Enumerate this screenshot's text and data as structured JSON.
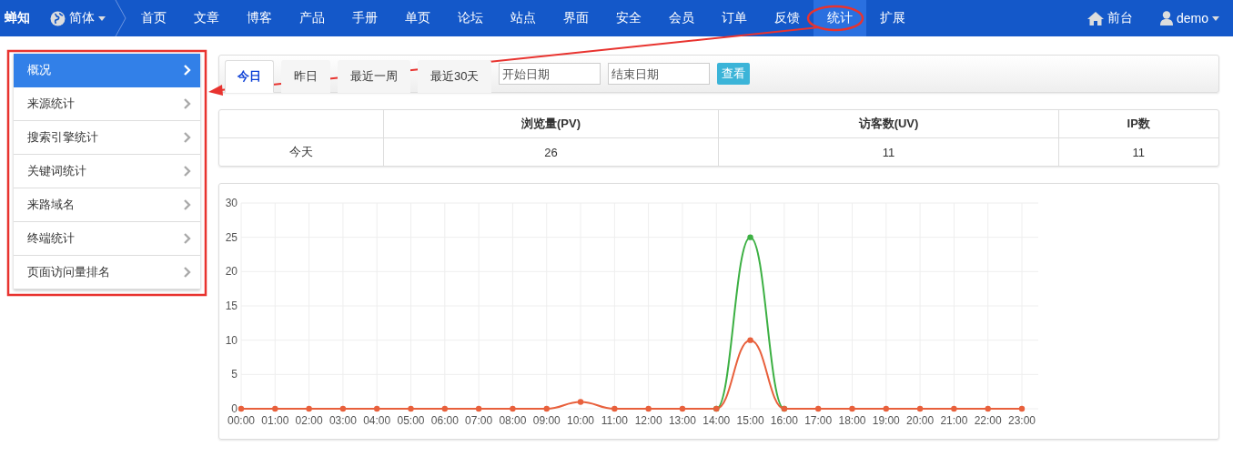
{
  "navbar": {
    "brand": "蝉知",
    "language": "简体",
    "items": [
      {
        "label": "首页",
        "selected": false
      },
      {
        "label": "文章",
        "selected": false
      },
      {
        "label": "博客",
        "selected": false
      },
      {
        "label": "产品",
        "selected": false
      },
      {
        "label": "手册",
        "selected": false
      },
      {
        "label": "单页",
        "selected": false
      },
      {
        "label": "论坛",
        "selected": false
      },
      {
        "label": "站点",
        "selected": false
      },
      {
        "label": "界面",
        "selected": false
      },
      {
        "label": "安全",
        "selected": false
      },
      {
        "label": "会员",
        "selected": false
      },
      {
        "label": "订单",
        "selected": false
      },
      {
        "label": "反馈",
        "selected": false
      },
      {
        "label": "统计",
        "selected": true
      },
      {
        "label": "扩展",
        "selected": false
      }
    ],
    "front_link": "前台",
    "user": "demo"
  },
  "sidebar": {
    "items": [
      {
        "label": "概况",
        "selected": true
      },
      {
        "label": "来源统计",
        "selected": false
      },
      {
        "label": "搜索引擎统计",
        "selected": false
      },
      {
        "label": "关键词统计",
        "selected": false
      },
      {
        "label": "来路域名",
        "selected": false
      },
      {
        "label": "终端统计",
        "selected": false
      },
      {
        "label": "页面访问量排名",
        "selected": false
      }
    ]
  },
  "toolbar": {
    "tabs": [
      {
        "label": "今日",
        "selected": true
      },
      {
        "label": "昨日",
        "selected": false
      },
      {
        "label": "最近一周",
        "selected": false
      },
      {
        "label": "最近30天",
        "selected": false
      }
    ],
    "start_date": {
      "placeholder": "开始日期"
    },
    "end_date": {
      "placeholder": "结束日期"
    },
    "button": "查看"
  },
  "table": {
    "columns": [
      "浏览量(PV)",
      "访客数(UV)",
      "IP数"
    ],
    "rows": [
      {
        "label": "今天",
        "values": [
          "26",
          "11",
          "11"
        ]
      }
    ]
  },
  "chart": {
    "chart_data": {
      "type": "line",
      "categories": [
        "00:00",
        "01:00",
        "02:00",
        "03:00",
        "04:00",
        "05:00",
        "06:00",
        "07:00",
        "08:00",
        "09:00",
        "10:00",
        "11:00",
        "12:00",
        "13:00",
        "14:00",
        "15:00",
        "16:00",
        "17:00",
        "18:00",
        "19:00",
        "20:00",
        "21:00",
        "22:00",
        "23:00"
      ],
      "ylim": [
        0,
        30
      ],
      "yticks": [
        0,
        5,
        10,
        15,
        20,
        25,
        30
      ],
      "grid": true,
      "series": [
        {
          "color": "#3cb043",
          "marker": true,
          "values": [
            null,
            null,
            null,
            null,
            null,
            null,
            null,
            null,
            null,
            null,
            null,
            null,
            null,
            null,
            0,
            25,
            0,
            null,
            null,
            null,
            null,
            null,
            null,
            null
          ]
        },
        {
          "color": "#e8603c",
          "marker": true,
          "values": [
            0,
            0,
            0,
            0,
            0,
            0,
            0,
            0,
            0,
            0,
            1,
            0,
            0,
            0,
            0,
            10,
            0,
            0,
            0,
            0,
            0,
            0,
            0,
            0
          ]
        }
      ]
    }
  },
  "annotations": [
    {
      "kind": "frame"
    },
    {
      "kind": "ellipse"
    },
    {
      "kind": "arrow"
    }
  ]
}
